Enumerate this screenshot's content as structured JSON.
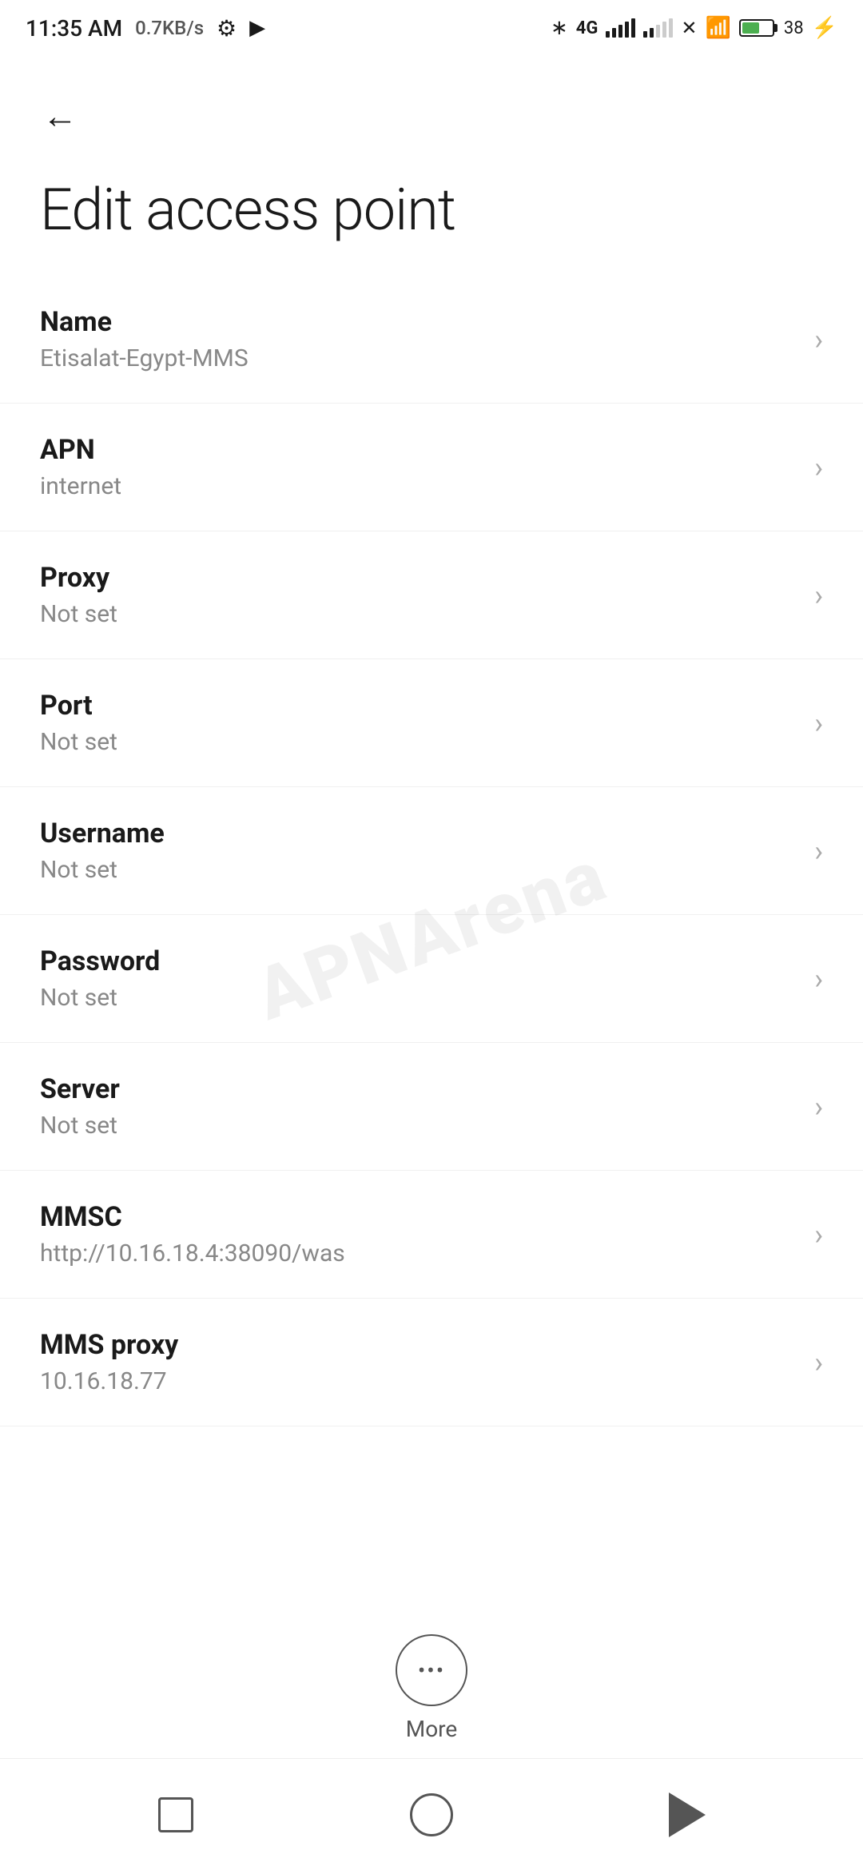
{
  "statusBar": {
    "time": "11:35 AM",
    "network_speed": "0.7KB/s"
  },
  "header": {
    "back_label": "←"
  },
  "page": {
    "title": "Edit access point"
  },
  "settings": {
    "items": [
      {
        "label": "Name",
        "value": "Etisalat-Egypt-MMS"
      },
      {
        "label": "APN",
        "value": "internet"
      },
      {
        "label": "Proxy",
        "value": "Not set"
      },
      {
        "label": "Port",
        "value": "Not set"
      },
      {
        "label": "Username",
        "value": "Not set"
      },
      {
        "label": "Password",
        "value": "Not set"
      },
      {
        "label": "Server",
        "value": "Not set"
      },
      {
        "label": "MMSC",
        "value": "http://10.16.18.4:38090/was"
      },
      {
        "label": "MMS proxy",
        "value": "10.16.18.77"
      }
    ]
  },
  "more_button": {
    "label": "More"
  },
  "watermark": {
    "text": "APNArena"
  },
  "navbar": {
    "items": [
      "square",
      "circle",
      "triangle"
    ]
  }
}
